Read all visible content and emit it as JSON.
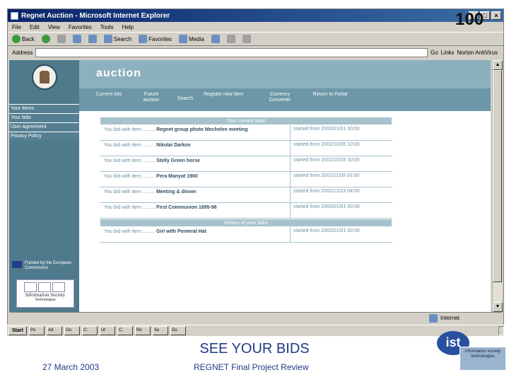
{
  "slide": {
    "number": "100",
    "heading": "SEE YOUR BIDS",
    "footer_date": "27 March 2003",
    "footer_title": "REGNET Final Project Review"
  },
  "browser": {
    "title": "Regnet Auction - Microsoft Internet Explorer",
    "menu": [
      "File",
      "Edit",
      "View",
      "Favorites",
      "Tools",
      "Help"
    ],
    "toolbar": [
      "Back",
      "Search",
      "Favorites",
      "Media"
    ],
    "address_label": "Address",
    "go_label": "Go",
    "links_label": "Links",
    "norton_label": "Norton AntiVirus",
    "status_text": "Internet"
  },
  "page": {
    "title": "auction",
    "nav": [
      {
        "label": "Current lots"
      },
      {
        "label": "Future auction"
      },
      {
        "label": "Search"
      },
      {
        "label": "Register new item"
      },
      {
        "label": "Currency Converter"
      },
      {
        "label": "Return to Portal"
      }
    ],
    "sidebar": [
      {
        "label": "Your items"
      },
      {
        "label": "Your bids"
      },
      {
        "label": "User Agreement"
      },
      {
        "label": "Privacy Policy"
      }
    ],
    "eu_text": "Funded by the European Commission",
    "ist_name": "Information Society",
    "ist_sub": "Technologies",
    "current_bids_title": "Your current bids!",
    "history_title": "History of your bids!",
    "bid_prefix": "You bid with item .........",
    "current_bids": [
      {
        "item": "Regnet group photo Mechelen meeting",
        "started": "started from 2002/01/01 00:00"
      },
      {
        "item": "Nikolai Darkov",
        "started": "started from 2002/10/05 10:00"
      },
      {
        "item": "Stelly Green horse",
        "started": "started from 2002/10/25 10:00"
      },
      {
        "item": "Pera Manyat 1900",
        "started": "started from 2002/11/09 00:00"
      },
      {
        "item": "Meeting & dinner",
        "started": "started from 2002/12/23 04:00"
      },
      {
        "item": "First Communion 1895-96",
        "started": "started from 2003/01/01 00:00"
      }
    ],
    "history_bids": [
      {
        "item": "Girl with Pomeral Hat",
        "started": "started from 2002/01/01 00:00"
      }
    ]
  },
  "taskbar": {
    "start": "Start",
    "tasks": [
      "Po",
      "Ad",
      "Ou",
      "C:",
      "Ut",
      "C:",
      "Re",
      "Su",
      "Do"
    ]
  },
  "ist_logo": {
    "mark": "ist",
    "tagline": "information society technologies"
  }
}
